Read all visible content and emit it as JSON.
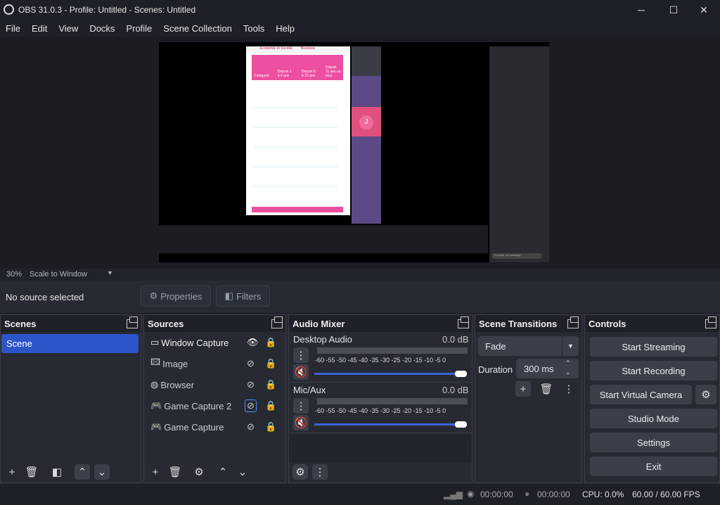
{
  "titlebar": {
    "title": "OBS 31.0.3 - Profile: Untitled - Scenes: Untitled",
    "minimize": "─",
    "maximize": "☐",
    "close": "✕"
  },
  "menu": [
    "File",
    "Edit",
    "View",
    "Docks",
    "Profile",
    "Scene Collection",
    "Tools",
    "Help"
  ],
  "preview": {
    "zoom": "30%",
    "scale_mode": "Scale to Window"
  },
  "source_toolbar": {
    "no_source": "No source selected",
    "properties": "Properties",
    "filters": "Filters"
  },
  "scenes": {
    "title": "Scenes",
    "items": [
      "Scene"
    ]
  },
  "sources": {
    "title": "Sources",
    "items": [
      "Window Capture",
      "Image",
      "Browser",
      "Game Capture 2",
      "Game Capture"
    ]
  },
  "mixer": {
    "title": "Audio Mixer",
    "channels": [
      {
        "name": "Desktop Audio",
        "level": "0.0 dB"
      },
      {
        "name": "Mic/Aux",
        "level": "0.0 dB"
      }
    ],
    "scale": "-60 -55 -50 -45 -40 -35 -30 -25 -20 -15 -10 -5 0"
  },
  "transitions": {
    "title": "Scene Transitions",
    "selected": "Fade",
    "duration_label": "Duration",
    "duration": "300 ms"
  },
  "controls": {
    "title": "Controls",
    "buttons": [
      "Start Streaming",
      "Start Recording",
      "Start Virtual Camera",
      "Studio Mode",
      "Settings",
      "Exit"
    ]
  },
  "status": {
    "stream_time": "00:00:00",
    "rec_time": "00:00:00",
    "cpu": "CPU: 0.0%",
    "fps": "60.00 / 60.00 FPS"
  },
  "canvas_content": {
    "table_headers": [
      "Catégorie",
      "Depuis 1 à 4 ans",
      "Depuis 5 à 10 ans",
      "Depuis 11 ans ou plus"
    ],
    "tabs": [
      "Économie et Société",
      "Business"
    ],
    "participant_initial": "J",
    "chat_placeholder": "Envoyer un message"
  }
}
